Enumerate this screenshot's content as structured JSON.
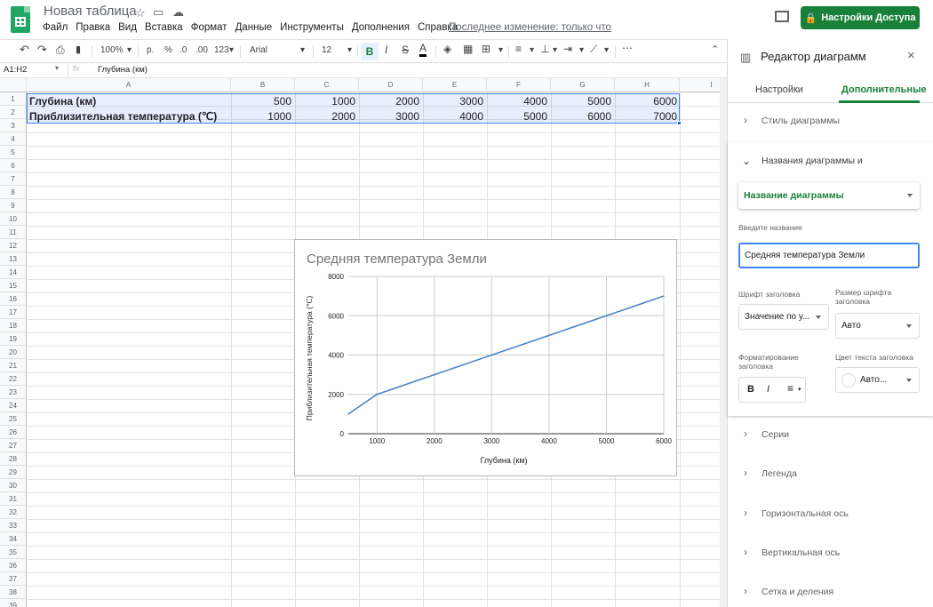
{
  "app": {
    "title": "Новая таблица",
    "menu": [
      "Файл",
      "Правка",
      "Вид",
      "Вставка",
      "Формат",
      "Данные",
      "Инструменты",
      "Дополнения",
      "Справка"
    ],
    "last_edit": "Последнее изменение: только что",
    "share_label": "Настройки Доступа",
    "accent": "#188038"
  },
  "toolbar": {
    "zoom": "100%",
    "currency": "р.",
    "percent": "%",
    "dec_less": ".0",
    "dec_more": ".00",
    "format": "123",
    "font": "Arial",
    "font_size": "12",
    "bold": "B",
    "italic": "I",
    "strike": "S",
    "textcolor": "A"
  },
  "formula_bar": {
    "cell_ref": "A1:H2",
    "fx": "fx",
    "content": "Глубина (км)"
  },
  "sheet": {
    "columns": [
      "A",
      "B",
      "C",
      "D",
      "E",
      "F",
      "G",
      "H",
      "I"
    ],
    "rows": [
      {
        "label": "Глубина (км)",
        "values": [
          "500",
          "1000",
          "2000",
          "3000",
          "4000",
          "5000",
          "6000"
        ]
      },
      {
        "label": "Приблизительная температура (℃)",
        "values": [
          "1000",
          "2000",
          "3000",
          "4000",
          "5000",
          "6000",
          "7000"
        ]
      }
    ],
    "row_count": 39
  },
  "chart_data": {
    "type": "line",
    "title": "Средняя температура Земли",
    "xlabel": "Глубина (км)",
    "ylabel": "Приблизительная температура (℃)",
    "x": [
      500,
      1000,
      2000,
      3000,
      4000,
      5000,
      6000
    ],
    "series": [
      {
        "values": [
          1000,
          2000,
          3000,
          4000,
          5000,
          6000,
          7000
        ],
        "color": "#4a86c8"
      }
    ],
    "xlim": [
      500,
      6000
    ],
    "ylim": [
      0,
      8000
    ],
    "x_ticks": [
      "1000",
      "2000",
      "3000",
      "4000",
      "5000",
      "6000"
    ],
    "y_ticks": [
      "0",
      "2000",
      "4000",
      "6000",
      "8000"
    ],
    "grid": true,
    "legend": "none"
  },
  "panel": {
    "title": "Редактор диаграмм",
    "tabs": [
      "Настройки",
      "Дополнительные"
    ],
    "sections": {
      "style": "Стиль диаграммы",
      "titles": "Названия диаграммы и",
      "series": "Серии",
      "legend": "Легенда",
      "h_axis": "Горизонтальная ось",
      "v_axis": "Вертикальная ось",
      "grid": "Сетка и деления"
    },
    "title_type": "Название диаграммы",
    "enter_title_label": "Введите название",
    "title_value": "Средняя температура Земли",
    "font_label": "Шрифт заголовка",
    "font_value": "Значение по у...",
    "size_label": "Размер шрифта заголовка",
    "size_value": "Авто",
    "format_label": "Форматирование заголовка",
    "color_label": "Цвет текста заголовка",
    "color_value": "Авто..."
  }
}
